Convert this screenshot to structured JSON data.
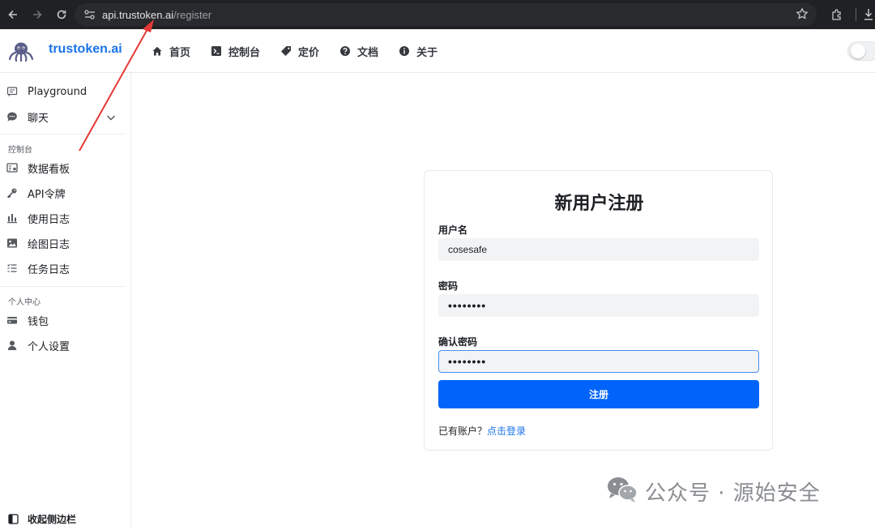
{
  "browser": {
    "url_host": "api.trustoken.ai",
    "url_path": "/register"
  },
  "header": {
    "logo_text": "trustoken.ai",
    "nav": [
      {
        "label": "首页",
        "icon": "home-icon"
      },
      {
        "label": "控制台",
        "icon": "terminal-icon"
      },
      {
        "label": "定价",
        "icon": "price-tag-icon"
      },
      {
        "label": "文档",
        "icon": "help-circle-icon"
      },
      {
        "label": "关于",
        "icon": "info-circle-icon"
      }
    ]
  },
  "sidebar": {
    "top_items": [
      {
        "label": "Playground",
        "icon": "playground-icon"
      },
      {
        "label": "聊天",
        "icon": "chat-bubble-icon"
      }
    ],
    "console_group_label": "控制台",
    "console_items": [
      {
        "label": "数据看板",
        "icon": "dashboard-icon"
      },
      {
        "label": "API令牌",
        "icon": "key-icon"
      },
      {
        "label": "使用日志",
        "icon": "bar-chart-icon"
      },
      {
        "label": "绘图日志",
        "icon": "image-icon"
      },
      {
        "label": "任务日志",
        "icon": "task-list-icon"
      }
    ],
    "personal_group_label": "个人中心",
    "personal_items": [
      {
        "label": "钱包",
        "icon": "wallet-icon"
      },
      {
        "label": "个人设置",
        "icon": "user-icon"
      }
    ],
    "collapse_label": "收起侧边栏"
  },
  "register": {
    "title": "新用户注册",
    "username_label": "用户名",
    "username_value": "cosesafe",
    "password_label": "密码",
    "password_value": "••••••••",
    "confirm_label": "确认密码",
    "confirm_value": "••••••••",
    "submit_label": "注册",
    "have_account_text": "已有账户？",
    "login_link": "点击登录"
  },
  "watermark": {
    "text": "公众号 · 源始安全"
  },
  "colors": {
    "primary": "#0064fa",
    "link": "#1a73e8",
    "annotation_arrow": "#e53935"
  }
}
